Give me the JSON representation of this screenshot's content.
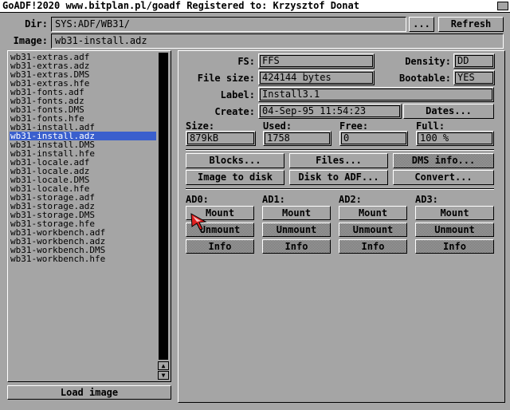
{
  "window": {
    "title": "GoADF!2020 www.bitplan.pl/goadf  Registered to: Krzysztof Donat"
  },
  "dir": {
    "label": "Dir:",
    "value": "SYS:ADF/WB31/",
    "browse_label": "...",
    "refresh_label": "Refresh"
  },
  "image": {
    "label": "Image:",
    "value": "wb31-install.adz"
  },
  "files": [
    "wb31-extras.adf",
    "wb31-extras.adz",
    "wb31-extras.DMS",
    "wb31-extras.hfe",
    "wb31-fonts.adf",
    "wb31-fonts.adz",
    "wb31-fonts.DMS",
    "wb31-fonts.hfe",
    "wb31-install.adf",
    "wb31-install.adz",
    "wb31-install.DMS",
    "wb31-install.hfe",
    "wb31-locale.adf",
    "wb31-locale.adz",
    "wb31-locale.DMS",
    "wb31-locale.hfe",
    "wb31-storage.adf",
    "wb31-storage.adz",
    "wb31-storage.DMS",
    "wb31-storage.hfe",
    "wb31-workbench.adf",
    "wb31-workbench.adz",
    "wb31-workbench.DMS",
    "wb31-workbench.hfe"
  ],
  "selected_index": 9,
  "load_label": "Load image",
  "info": {
    "fs_label": "FS:",
    "fs": "FFS",
    "density_label": "Density:",
    "density": "DD",
    "filesize_label": "File size:",
    "filesize": "424144 bytes",
    "bootable_label": "Bootable:",
    "bootable": "YES",
    "label_label": "Label:",
    "label": "Install3.1",
    "create_label": "Create:",
    "create": "04-Sep-95 11:54:23",
    "dates_label": "Dates..."
  },
  "usage": {
    "size_label": "Size:",
    "size": "879kB",
    "used_label": "Used:",
    "used": "1758",
    "free_label": "Free:",
    "free": "0",
    "full_label": "Full:",
    "full": "100 %"
  },
  "actions": {
    "blocks": "Blocks...",
    "files": "Files...",
    "dms": "DMS info...",
    "image_to_disk": "Image to disk",
    "disk_to_adf": "Disk to ADF...",
    "convert": "Convert..."
  },
  "drives": [
    {
      "name": "AD0:",
      "mount": "Mount",
      "unmount": "Unmount",
      "info": "Info"
    },
    {
      "name": "AD1:",
      "mount": "Mount",
      "unmount": "Unmount",
      "info": "Info"
    },
    {
      "name": "AD2:",
      "mount": "Mount",
      "unmount": "Unmount",
      "info": "Info"
    },
    {
      "name": "AD3:",
      "mount": "Mount",
      "unmount": "Unmount",
      "info": "Info"
    }
  ],
  "scroll": {
    "up": "▲",
    "down": "▼"
  },
  "colors": {
    "background": "#a5a5a5",
    "selection": "#3a5fcd",
    "pointer": "#e02020"
  }
}
